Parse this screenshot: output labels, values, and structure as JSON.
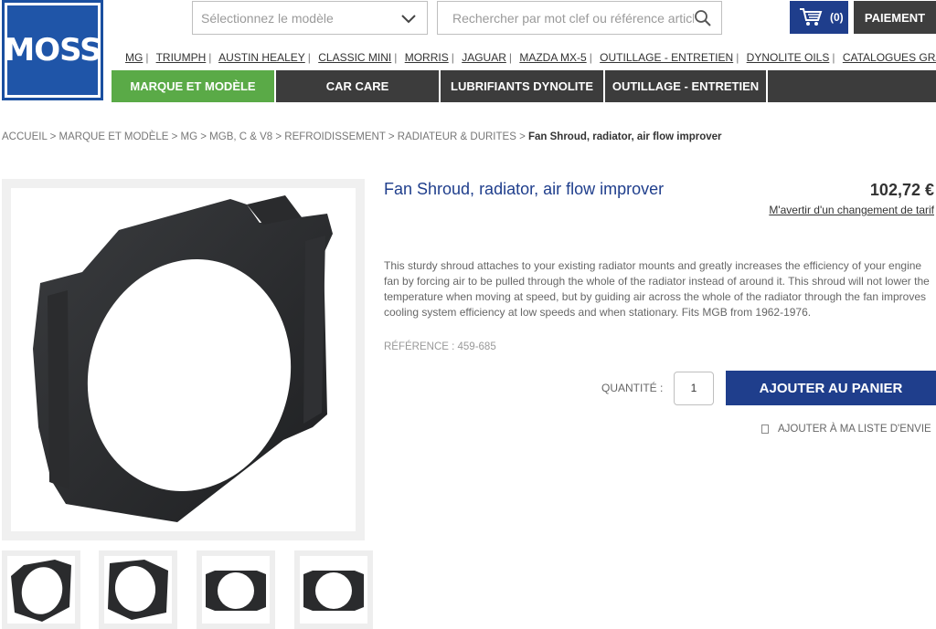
{
  "header": {
    "logo_text": "MOSS",
    "model_select_placeholder": "Sélectionnez le modèle",
    "search_placeholder": "Rechercher par mot clef ou référence article",
    "cart_count": "(0)",
    "checkout_label": "PAIEMENT"
  },
  "brand_links": [
    "MG",
    "TRIUMPH",
    "AUSTIN HEALEY",
    "CLASSIC MINI",
    "MORRIS",
    "JAGUAR",
    "MAZDA MX-5",
    "OUTILLAGE - ENTRETIEN",
    "DYNOLITE OILS",
    "CATALOGUES GRATUITS"
  ],
  "nav": {
    "items": [
      "MARQUE ET MODÈLE",
      "CAR CARE",
      "LUBRIFIANTS DYNOLITE",
      "OUTILLAGE - ENTRETIEN"
    ]
  },
  "breadcrumb": {
    "path": "ACCUEIL > MARQUE ET MODÈLE > MG > MGB, C & V8 > REFROIDISSEMENT > RADIATEUR & DURITES > ",
    "current": "Fan Shroud, radiator, air flow improver"
  },
  "product": {
    "title": "Fan Shroud, radiator, air flow improver",
    "price": "102,72 €",
    "notify_label": "M'avertir d'un changement de tarif",
    "description": "This sturdy shroud attaches to your existing radiator mounts and greatly increases the efficiency of your engine fan by forcing air to be pulled through the whole of the radiator instead of around it. This shroud will not lower the temperature when moving at speed, but by guiding air across the whole of the radiator through the fan improves cooling system efficiency at low speeds and when stationary. Fits MGB from 1962-1976.",
    "reference": "RÉFÉRENCE : 459-685",
    "quantity_label": "QUANTITÉ :",
    "quantity_value": "1",
    "add_to_cart_label": "AJOUTER AU PANIER",
    "wishlist_label": "AJOUTER À MA LISTE D'ENVIE"
  },
  "colors": {
    "brand_blue": "#1f3e8c",
    "nav_dark": "#3c3c3c",
    "nav_active": "#5aaa47"
  }
}
